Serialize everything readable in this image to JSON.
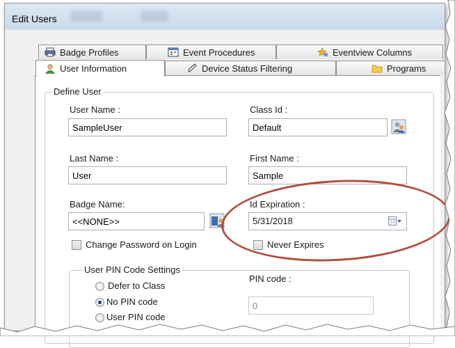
{
  "window": {
    "title": "Edit Users"
  },
  "tabs": {
    "row1": [
      {
        "label": "Badge Profiles",
        "icon": "badge-printer-icon"
      },
      {
        "label": "Event Procedures",
        "icon": "event-calendar-icon"
      },
      {
        "label": "Eventview Columns",
        "icon": "columns-star-icon"
      }
    ],
    "row2": [
      {
        "label": "User Information",
        "icon": "user-icon",
        "active": true
      },
      {
        "label": "Device Status Filtering",
        "icon": "pencil-icon"
      },
      {
        "label": "Programs",
        "icon": "folder-icon"
      }
    ]
  },
  "define_user": {
    "legend": "Define User",
    "user_name": {
      "label": "User Name :",
      "value": "SampleUser"
    },
    "class_id": {
      "label": "Class Id :",
      "value": "Default"
    },
    "last_name": {
      "label": "Last Name :",
      "value": "User"
    },
    "first_name": {
      "label": "First Name :",
      "value": "Sample"
    },
    "badge_name": {
      "label": "Badge Name:",
      "value": "<<NONE>>"
    },
    "id_expiration": {
      "label": "Id Expiration :",
      "value": "5/31/2018"
    },
    "change_password": {
      "label": "Change Password on Login",
      "checked": false
    },
    "never_expires": {
      "label": "Never Expires",
      "checked": false
    }
  },
  "pin_settings": {
    "legend": "User PIN Code Settings",
    "options": [
      {
        "label": "Defer to Class",
        "selected": false
      },
      {
        "label": "No PIN code",
        "selected": true
      },
      {
        "label": "User PIN code",
        "selected": false
      }
    ],
    "pin_code": {
      "label": "PIN code :",
      "value": "0"
    }
  },
  "colors": {
    "highlight_oval": "#b04f3e",
    "title_bar": "#c9d9ea"
  }
}
